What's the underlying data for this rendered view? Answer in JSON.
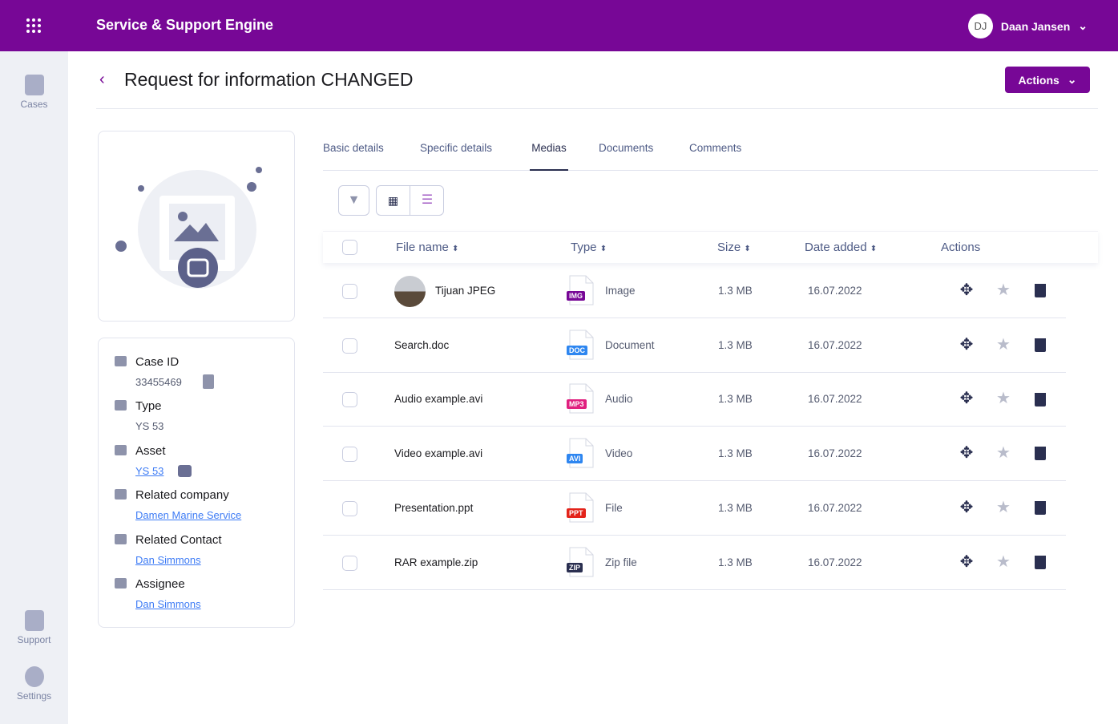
{
  "header": {
    "app_title": "Service & Support Engine",
    "user_initials": "DJ",
    "user_name": "Daan Jansen"
  },
  "sidebar": {
    "items": [
      {
        "label": "Cases",
        "icon": "file-icon"
      },
      {
        "label": "Support",
        "icon": "qa-icon"
      },
      {
        "label": "Settings",
        "icon": "gear-icon"
      }
    ]
  },
  "page": {
    "title": "Request for information CHANGED",
    "actions_label": "Actions"
  },
  "details": [
    {
      "label": "Case ID",
      "value": "33455469",
      "icon": "fingerprint-icon",
      "link": false
    },
    {
      "label": "Type",
      "value": "YS 53",
      "icon": "hierarchy-icon",
      "link": false
    },
    {
      "label": "Asset",
      "value": "YS 53",
      "icon": "asset-icon",
      "link": true
    },
    {
      "label": "Related company",
      "value": "Damen Marine Service",
      "icon": "building-icon",
      "link": true
    },
    {
      "label": "Related Contact",
      "value": "Dan Simmons",
      "icon": "contact-icon",
      "link": true
    },
    {
      "label": "Assignee",
      "value": "Dan Simmons",
      "icon": "contact-icon",
      "link": true
    }
  ],
  "tabs": [
    "Basic details",
    "Specific details",
    "Medias",
    "Documents",
    "Comments"
  ],
  "active_tab": "Medias",
  "table": {
    "headers": {
      "file_name": "File name",
      "type": "Type",
      "size": "Size",
      "date": "Date added",
      "actions": "Actions"
    },
    "rows": [
      {
        "name": "Tijuan JPEG",
        "badge": "IMG",
        "badge_color": "#770796",
        "type": "Image",
        "size": "1.3 MB",
        "date": "16.07.2022"
      },
      {
        "name": "Search.doc",
        "badge": "DOC",
        "badge_color": "#2e86f0",
        "type": "Document",
        "size": "1.3 MB",
        "date": "16.07.2022"
      },
      {
        "name": "Audio example.avi",
        "badge": "MP3",
        "badge_color": "#e0207f",
        "type": "Audio",
        "size": "1.3 MB",
        "date": "16.07.2022"
      },
      {
        "name": "Video example.avi",
        "badge": "AVI",
        "badge_color": "#2e86f0",
        "type": "Video",
        "size": "1.3 MB",
        "date": "16.07.2022"
      },
      {
        "name": "Presentation.ppt",
        "badge": "PPT",
        "badge_color": "#e3241b",
        "type": "File",
        "size": "1.3 MB",
        "date": "16.07.2022"
      },
      {
        "name": "RAR example.zip",
        "badge": "ZIP",
        "badge_color": "#2a2f50",
        "type": "Zip file",
        "size": "1.3 MB",
        "date": "16.07.2022"
      }
    ]
  }
}
